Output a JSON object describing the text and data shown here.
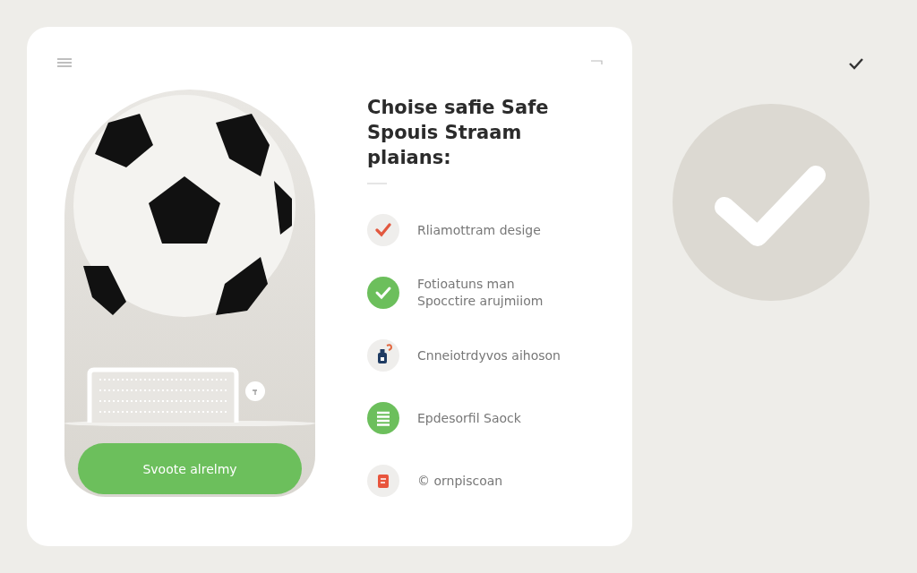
{
  "hero": {
    "button": "Svoote alrelmy"
  },
  "title": "Choise safie Safe Spouis Straam plaians:",
  "features": [
    {
      "kind": "check",
      "text": "Rliamottram desige"
    },
    {
      "kind": "check-circle",
      "text": "Fotioatuns man\nSpocctire arujmiiom"
    },
    {
      "kind": "bottle",
      "text": "Cnneiotrdyvos aihoson"
    },
    {
      "kind": "list",
      "text": "Epdesorfil Saock"
    },
    {
      "kind": "doc",
      "text": "© ornpiscoan"
    }
  ]
}
